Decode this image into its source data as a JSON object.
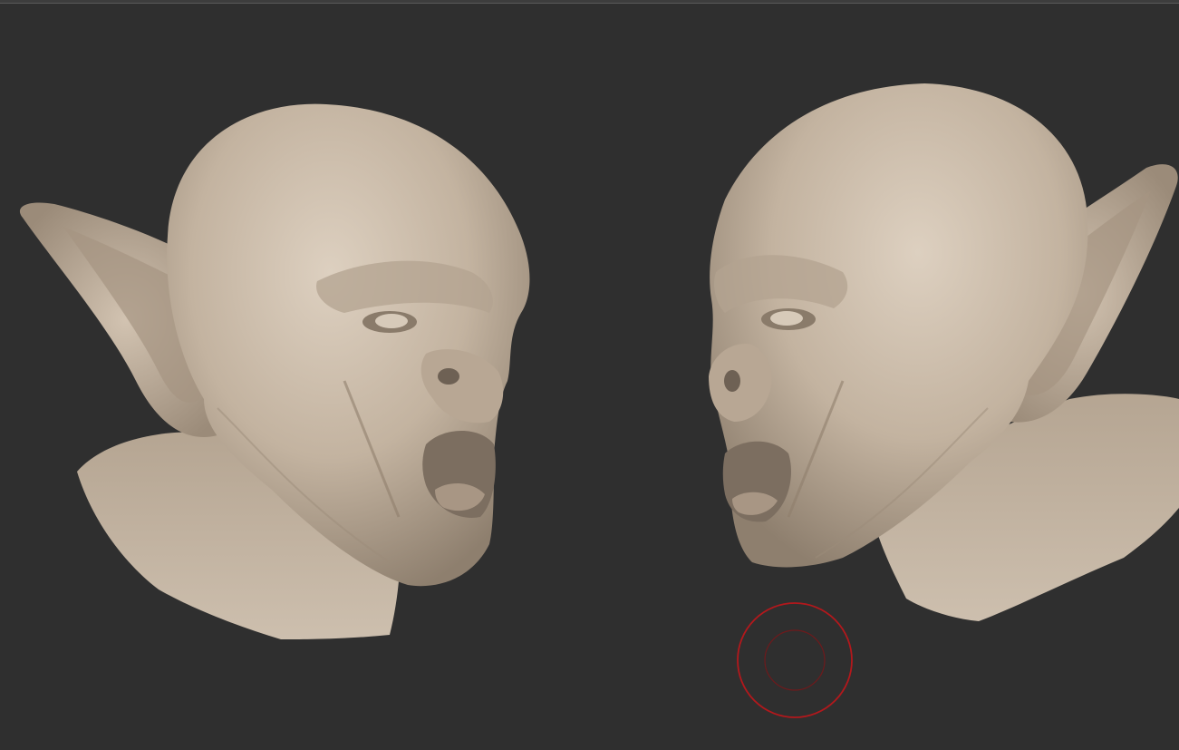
{
  "scene": {
    "background_color": "#2f2f2f",
    "model_color": "#c9b9a6",
    "brush_cursor_color": "#b3181c",
    "models": [
      {
        "name": "sculpt-head-left-facing-right"
      },
      {
        "name": "sculpt-head-right-facing-left"
      }
    ],
    "brush_cursor": {
      "icon": "brush-cursor-icon"
    }
  }
}
